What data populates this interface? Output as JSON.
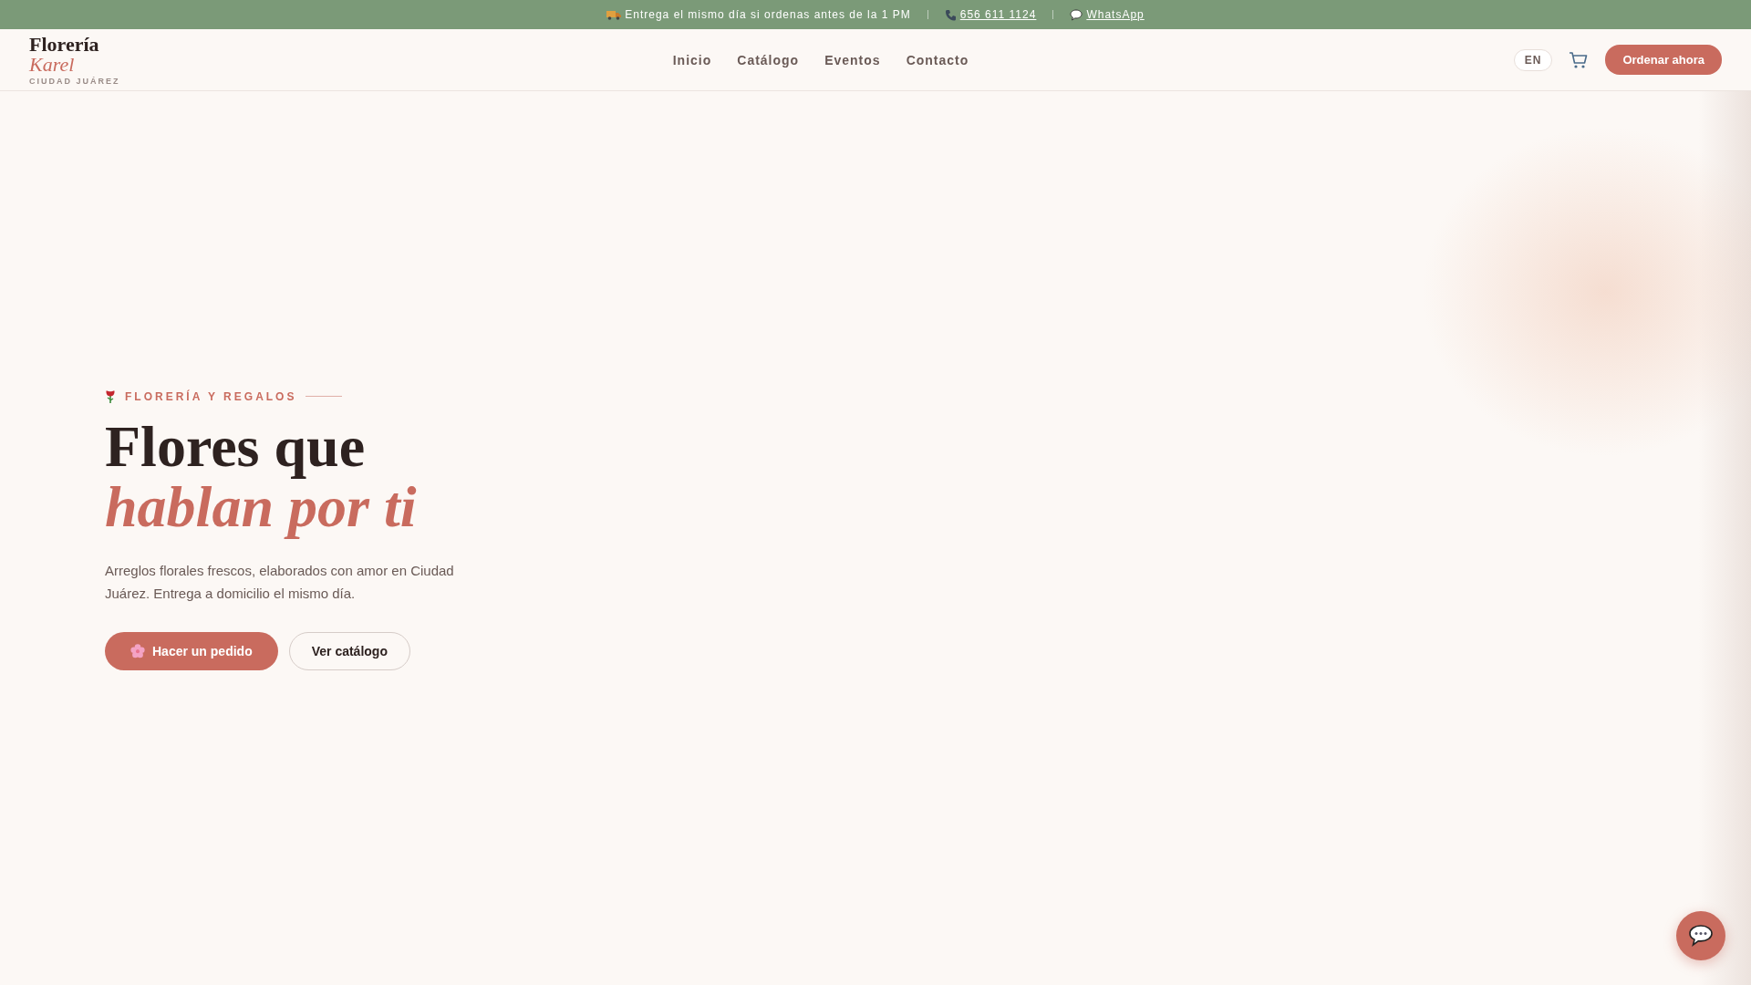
{
  "announcement": {
    "delivery_text": "Entrega el mismo día si ordenas antes de la 1 PM",
    "phone": "656 611 1124",
    "whatsapp": "WhatsApp"
  },
  "header": {
    "logo": {
      "line_1": "Florería",
      "line_2": "Karel",
      "tagline": "CIUDAD JUÁREZ"
    },
    "nav": [
      {
        "label": "Inicio"
      },
      {
        "label": "Catálogo"
      },
      {
        "label": "Eventos"
      },
      {
        "label": "Contacto"
      }
    ],
    "language": "EN",
    "order_button": "Ordenar ahora"
  },
  "hero": {
    "eyebrow": "FLORERÍA Y REGALOS",
    "title_line_1": "Flores que",
    "title_line_2": "hablan por ti",
    "description": "Arreglos florales frescos, elaborados con amor en Ciudad Juárez. Entrega a domicilio el mismo día.",
    "buttons": [
      {
        "kind": "primary",
        "label": "Hacer un pedido"
      },
      {
        "kind": "secondary",
        "label": "Ver catálogo"
      }
    ]
  }
}
